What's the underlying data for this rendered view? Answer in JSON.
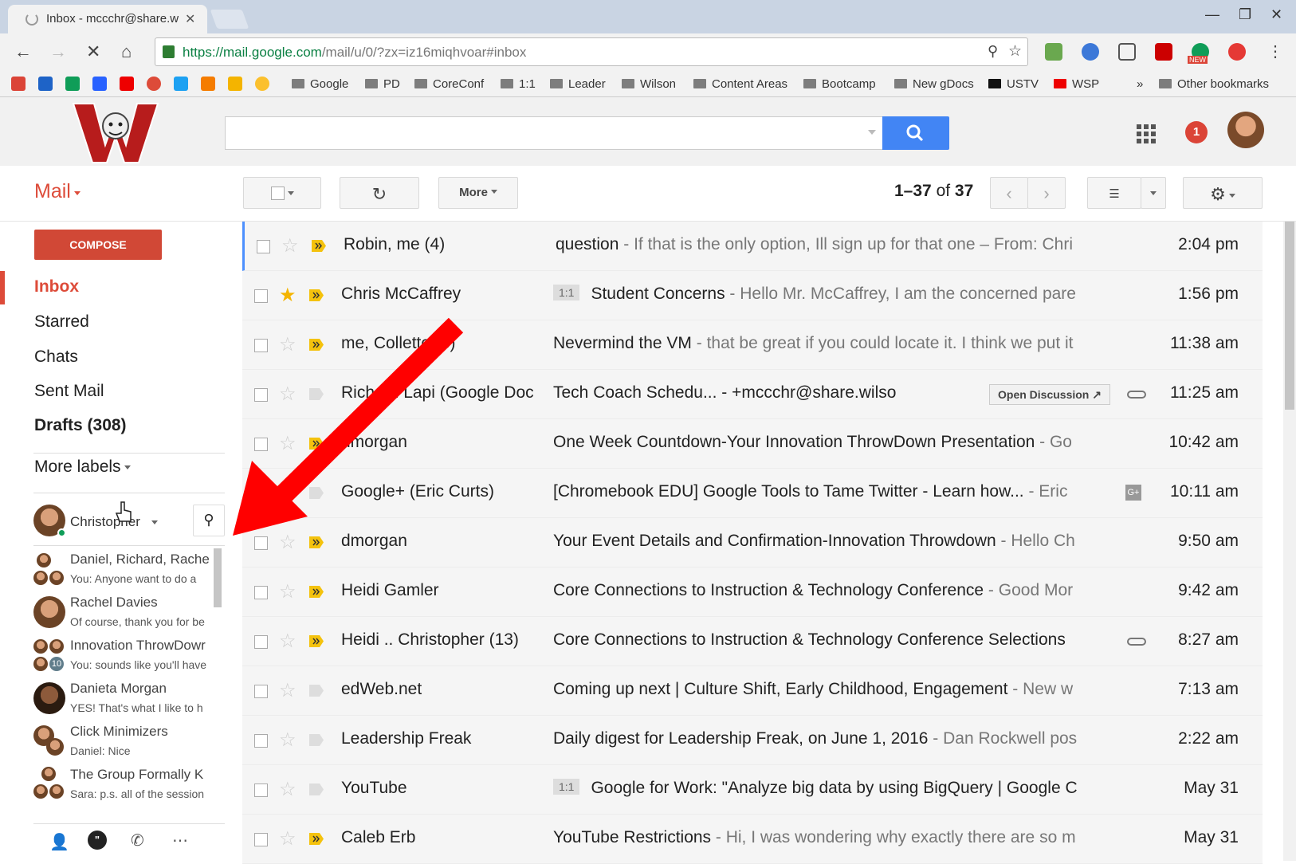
{
  "browser": {
    "tab_title": "Inbox - mccchr@share.w",
    "url_host": "https://mail.google.com",
    "url_path": "/mail/u/0/?zx=iz16miqhvoar#inbox",
    "bookmarks": [
      "Google",
      "PD",
      "CoreConf",
      "1:1",
      "Leader",
      "Wilson",
      "Content Areas",
      "Bootcamp",
      "New gDocs",
      "USTV",
      "WSP"
    ],
    "overflow": "»",
    "other_bookmarks": "Other bookmarks",
    "new_badge": "NEW"
  },
  "header": {
    "notification_count": "1"
  },
  "mailbar": {
    "mail_label": "Mail",
    "more_label": "More",
    "count_range": "1–37",
    "count_of": "of",
    "count_total": "37"
  },
  "sidebar": {
    "compose": "COMPOSE",
    "nav": [
      "Inbox",
      "Starred",
      "Chats",
      "Sent Mail",
      "Drafts (308)"
    ],
    "more_labels": "More labels",
    "chat_user": "Christopher",
    "chats": [
      {
        "name": "Daniel, Richard, Rache",
        "msg": "You: Anyone want to do a"
      },
      {
        "name": "Rachel Davies",
        "msg": "Of course, thank you for be"
      },
      {
        "name": "Innovation ThrowDowr",
        "msg": "You: sounds like you'll have",
        "badge": "10"
      },
      {
        "name": "Danieta Morgan",
        "msg": "YES! That's what I like to h"
      },
      {
        "name": "Click Minimizers",
        "msg": "Daniel: Nice"
      },
      {
        "name": "The Group Formally K",
        "msg": "Sara: p.s. all of the session"
      }
    ]
  },
  "emails": [
    {
      "sender": "Robin, me (4)",
      "label": "",
      "subject": "question",
      "preview": " - If that is the only option, Ill sign up for that one – From: Chri",
      "time": "2:04 pm",
      "starred": false,
      "important": true
    },
    {
      "sender": "Chris McCaffrey",
      "label": "1:1",
      "subject": "Student Concerns",
      "preview": " - Hello Mr. McCaffrey, I am the concerned pare",
      "time": "1:56 pm",
      "starred": true,
      "important": true
    },
    {
      "sender": "me, Collette (3)",
      "label": "",
      "subject": "Nevermind the VM",
      "preview": " - that be great if you could locate it. I think we put it",
      "time": "11:38 am",
      "starred": false,
      "important": true
    },
    {
      "sender": "Richard Lapi (Google Doc",
      "label": "",
      "subject": "Tech Coach Schedu... - +mccchr@share.wilso",
      "preview": "",
      "time": "11:25 am",
      "starred": false,
      "important": false,
      "button": "Open Discussion ↗",
      "attach": true
    },
    {
      "sender": "dmorgan",
      "label": "",
      "subject": "One Week Countdown-Your Innovation ThrowDown Presentation",
      "preview": " - Go",
      "time": "10:42 am",
      "starred": false,
      "important": true
    },
    {
      "sender": "Google+ (Eric Curts)",
      "label": "",
      "subject": "[Chromebook EDU] Google Tools to Tame Twitter - Learn how...",
      "preview": " - Eric",
      "time": "10:11 am",
      "starred": false,
      "important": false,
      "gplus": "G+"
    },
    {
      "sender": "dmorgan",
      "label": "",
      "subject": "Your Event Details and Confirmation-Innovation Throwdown",
      "preview": " - Hello Ch",
      "time": "9:50 am",
      "starred": false,
      "important": true
    },
    {
      "sender": "Heidi Gamler",
      "label": "",
      "subject": "Core Connections to Instruction & Technology Conference",
      "preview": " - Good Mor",
      "time": "9:42 am",
      "starred": false,
      "important": true
    },
    {
      "sender": "Heidi .. Christopher (13)",
      "label": "",
      "subject": "Core Connections to Instruction & Technology Conference Selections",
      "preview": "",
      "time": "8:27 am",
      "starred": false,
      "important": true,
      "attach": true
    },
    {
      "sender": "edWeb.net",
      "label": "",
      "subject": "Coming up next | Culture Shift, Early Childhood, Engagement",
      "preview": " - New w",
      "time": "7:13 am",
      "starred": false,
      "important": false
    },
    {
      "sender": "Leadership Freak",
      "label": "",
      "subject": "Daily digest for Leadership Freak, on June 1, 2016",
      "preview": " - Dan Rockwell pos",
      "time": "2:22 am",
      "starred": false,
      "important": false
    },
    {
      "sender": "YouTube",
      "label": "1:1",
      "subject": "Google for Work: \"Analyze big data by using BigQuery | Google C",
      "preview": "",
      "time": "May 31",
      "starred": false,
      "important": false
    },
    {
      "sender": "Caleb Erb",
      "label": "",
      "subject": "YouTube Restrictions",
      "preview": " - Hi, I was wondering why exactly there are so m",
      "time": "May 31",
      "starred": false,
      "important": true
    }
  ],
  "colors": {
    "accent": "#dd4b39",
    "search_button": "#4285f4",
    "compose": "#d14836",
    "star": "#f4b400",
    "arrow": "#ff0000"
  }
}
